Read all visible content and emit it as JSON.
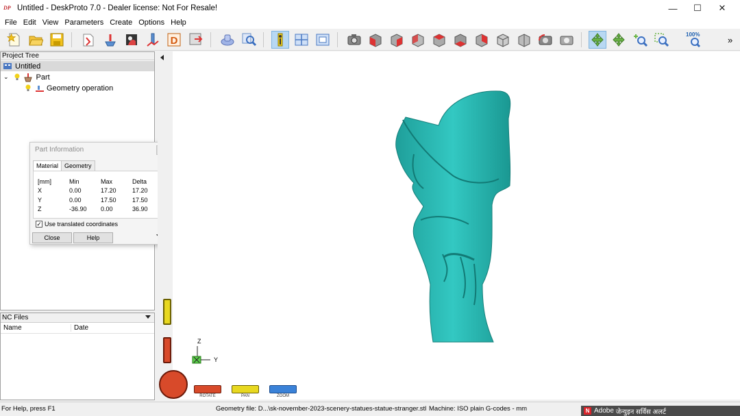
{
  "window": {
    "title": "Untitled - DeskProto 7.0 - Dealer license: Not For Resale!",
    "icon_text": "DP",
    "minimize_glyph": "—",
    "maximize_glyph": "☐",
    "close_glyph": "✕"
  },
  "menu": [
    "File",
    "Edit",
    "View",
    "Parameters",
    "Create",
    "Options",
    "Help"
  ],
  "toolbar": {
    "zoom_label": "100%",
    "overflow": "»"
  },
  "project_tree": {
    "header": "Project Tree",
    "root": "Untitled",
    "part": "Part",
    "operation": "Geometry operation"
  },
  "part_info": {
    "title": "Part Information",
    "tabs": [
      "Material",
      "Geometry"
    ],
    "headers": [
      "[mm]",
      "Min",
      "Max",
      "Delta"
    ],
    "rows": [
      [
        "X",
        "0.00",
        "17.20",
        "17.20"
      ],
      [
        "Y",
        "0.00",
        "17.50",
        "17.50"
      ],
      [
        "Z",
        "-36.90",
        "0.00",
        "36.90"
      ]
    ],
    "checkbox_label": "Use translated coordinates",
    "checkbox_checked": true,
    "close_label": "Close",
    "help_label": "Help"
  },
  "nc_files": {
    "header": "NC Files",
    "col_name": "Name",
    "col_date": "Date"
  },
  "viewport": {
    "axis_z": "Z",
    "axis_y": "Y",
    "model_color": "#2ab5b0",
    "nav": [
      "ROTATE",
      "PAN",
      "ZOOM"
    ]
  },
  "status": {
    "help": "For Help, press F1",
    "geometry": "Geometry file: D...\\sk-november-2023-scenery-statues-statue-stranger.stl",
    "machine": "Machine: ISO plain G-codes - mm"
  },
  "notification": {
    "app": "Adobe",
    "text": "जेन्युइन सर्विस अलर्ट"
  }
}
